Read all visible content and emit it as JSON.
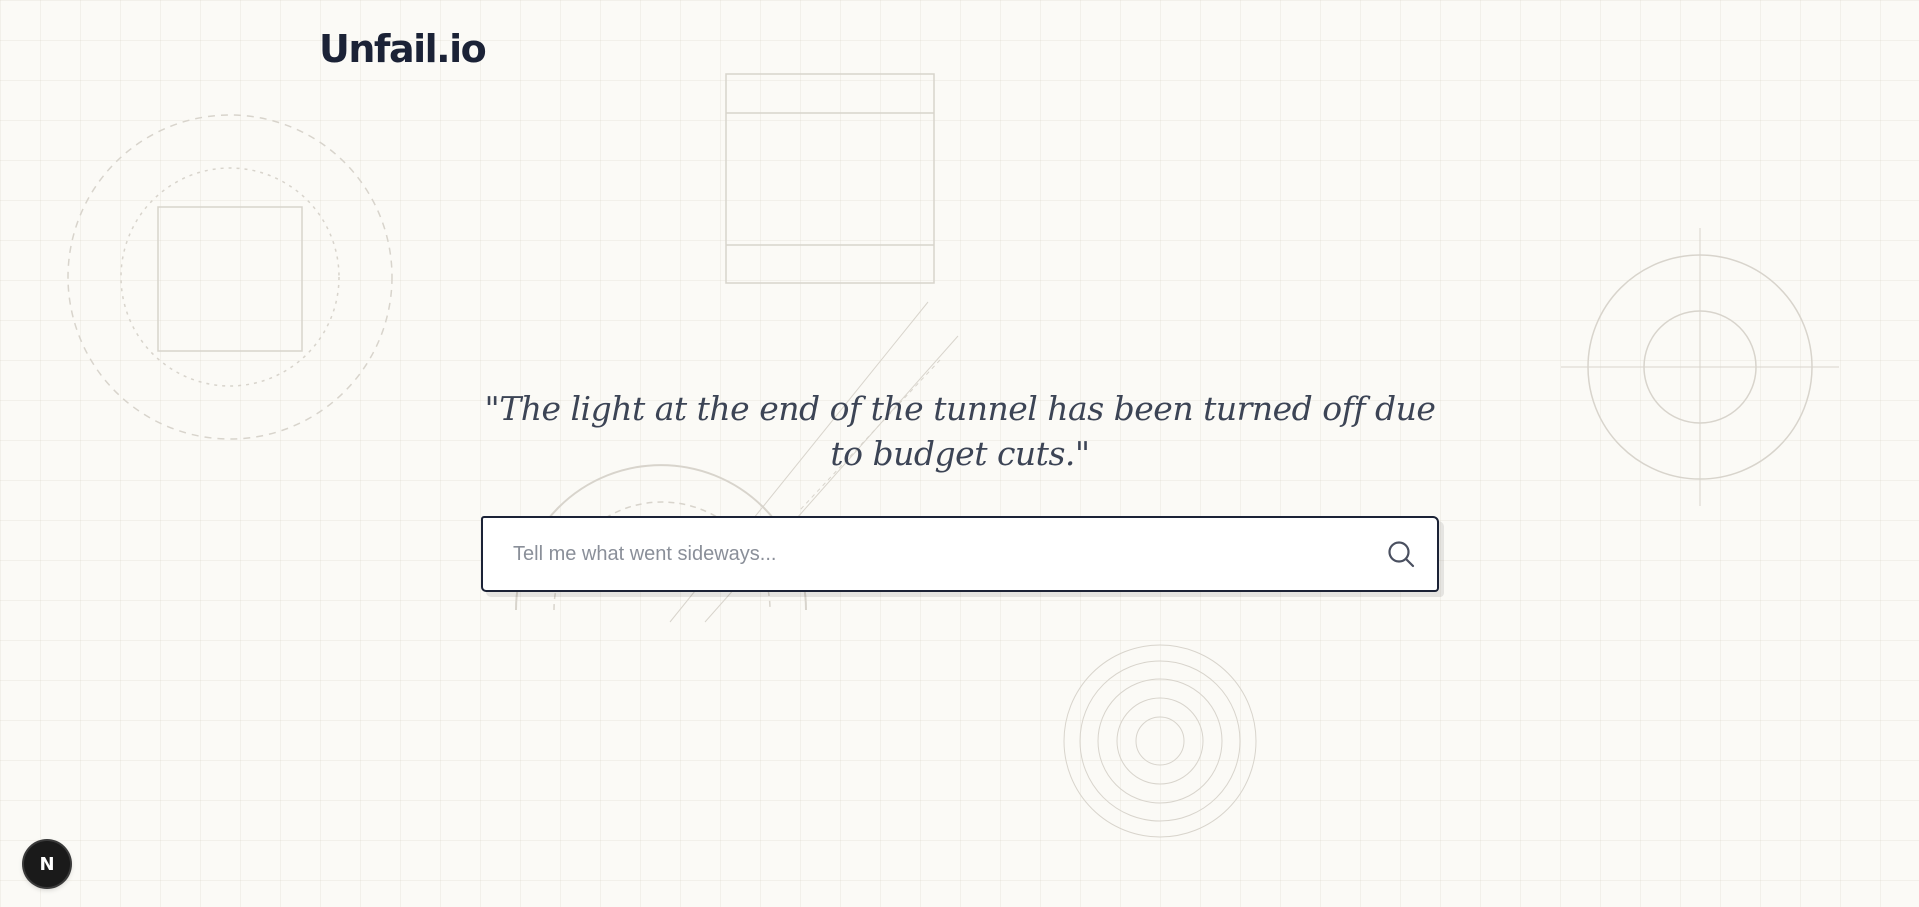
{
  "header": {
    "logo_text": "Unfail.io"
  },
  "hero": {
    "quote": "\"The light at the end of the tunnel has been turned off due to budget cuts.\""
  },
  "search": {
    "placeholder": "Tell me what went sideways...",
    "value": "",
    "icon": "search-icon"
  },
  "dev_badge": {
    "letter": "N"
  },
  "colors": {
    "background": "#fbfaf6",
    "ink": "#1b2236",
    "quote_text": "#3c4455",
    "decor_stroke": "#d8d4cc"
  }
}
